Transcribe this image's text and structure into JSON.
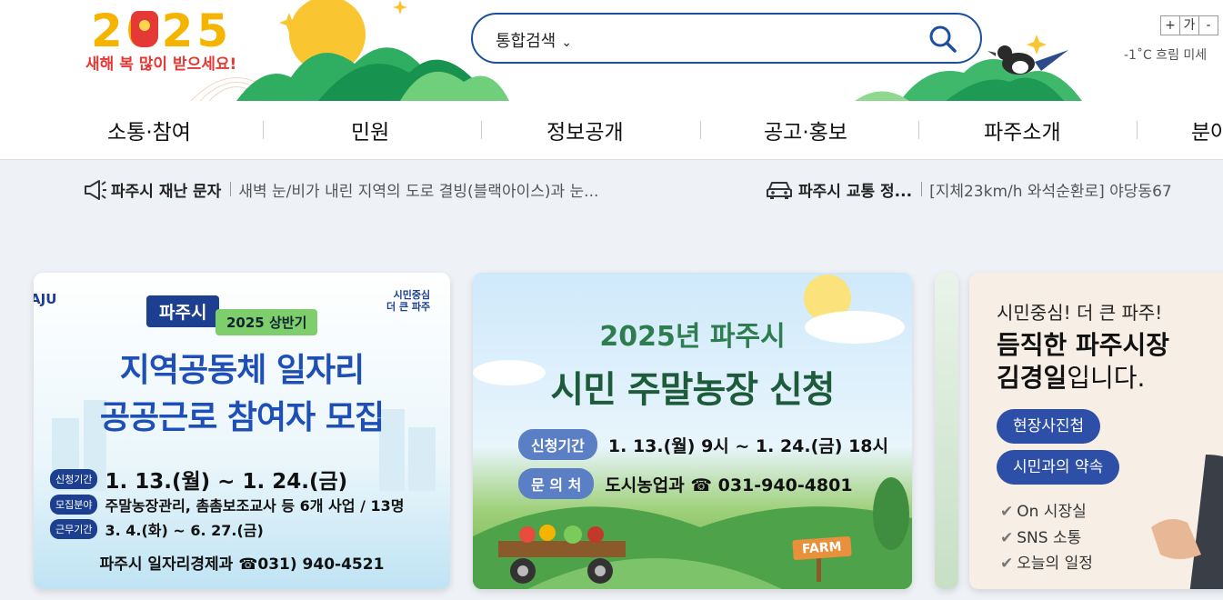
{
  "header": {
    "banner_year": "2025",
    "banner_greeting": "새해 복 많이 받으세요!",
    "search": {
      "scope": "통합검색",
      "placeholder": ""
    },
    "font_controls": [
      "+",
      "가",
      "-"
    ],
    "weather": "-1˚C 흐림 미세"
  },
  "nav": {
    "items": [
      "소통·참여",
      "민원",
      "정보공개",
      "공고·홍보",
      "파주소개",
      "분야"
    ]
  },
  "alerts": [
    {
      "icon": "megaphone-icon",
      "title": "파주시 재난 문자",
      "text": "새벽 눈/비가 내린 지역의 도로 결빙(블랙아이스)과 눈..."
    },
    {
      "icon": "car-icon",
      "title": "파주시 교통 정...",
      "text": "[지체23km/h 와석순환로] 야당동67"
    }
  ],
  "cards": {
    "jobs": {
      "logo": "AJU",
      "slogan_line1": "시민중심",
      "slogan_line2": "더 큰 파주",
      "city": "파주시",
      "half": "2025 상반기",
      "title1": "지역공동체 일자리",
      "title2": "공공근로 참여자 모집",
      "period_label": "신청기간",
      "period_value": "1. 13.(월) ~ 1. 24.(금)",
      "field_label": "모집분야",
      "field_value": "주말농장관리, 촘촘보조교사 등 6개 사업 / 13명",
      "work_label": "근무기간",
      "work_value": "3. 4.(화) ~ 6. 27.(금)",
      "contact": "파주시 일자리경제과 ☎031) 940-4521"
    },
    "farm": {
      "title1": "2025년 파주시",
      "title2": "시민 주말농장 신청",
      "period_label": "신청기간",
      "period_value": "1. 13.(월) 9시 ~ 1. 24.(금) 18시",
      "contact_label": "문 의 처",
      "contact_value": "도시농업과 ☎ 031-940-4801",
      "sign": "FARM"
    },
    "mayor": {
      "line1": "시민중심! 더 큰 파주!",
      "line2": "듬직한 파주시장",
      "name": "김경일",
      "name_suffix": "입니다.",
      "btn1": "현장사진첩",
      "btn2": "시민과의 약속",
      "links": [
        "On 시장실",
        "SNS 소통",
        "오늘의 일정"
      ]
    }
  }
}
